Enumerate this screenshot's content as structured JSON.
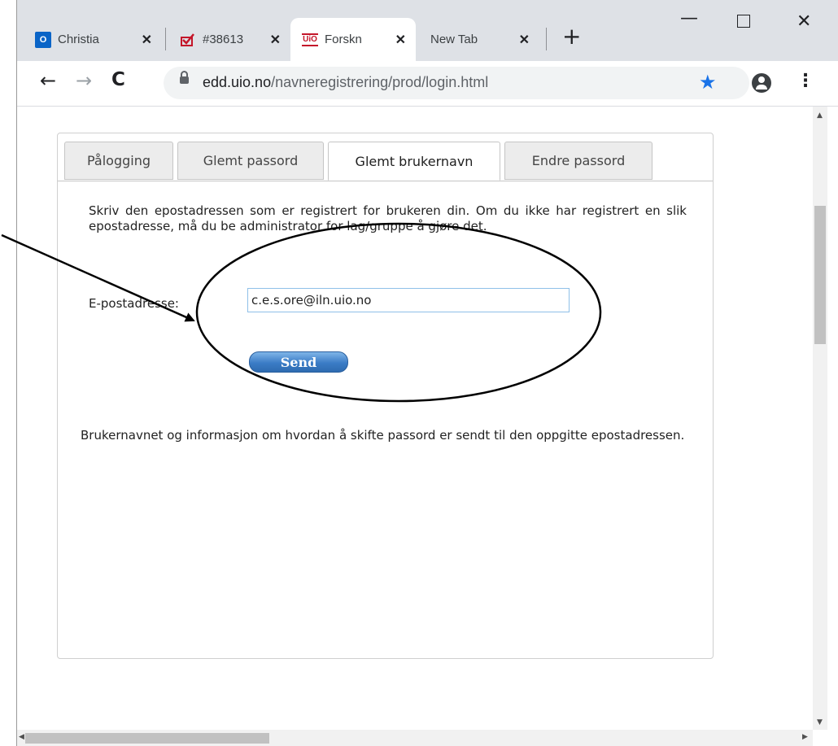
{
  "browser": {
    "tabs": [
      {
        "icon": "outlook-icon",
        "title": "Christia"
      },
      {
        "icon": "checkmark-task-icon",
        "title": "#38613"
      },
      {
        "icon": "uio-icon",
        "title": "Forskn"
      },
      {
        "icon": "",
        "title": "New Tab"
      }
    ],
    "favicon_labels": {
      "outlook": "O",
      "uio": "UiO"
    },
    "url_host": "edd.uio.no",
    "url_path": "/navneregistrering/prod/login.html",
    "accent_color": "#1a73e8"
  },
  "page": {
    "tabs": [
      "Pålogging",
      "Glemt passord",
      "Glemt brukernavn",
      "Endre passord"
    ],
    "active_tab": "Glemt brukernavn",
    "instructions": "Skriv den epostadressen som er registrert for brukeren din. Om du ikke har registrert en slik epostadresse, må du be administrator for lag/gruppe å gjøre det.",
    "email_label": "E-postadresse:",
    "email_value": "c.e.s.ore@iln.uio.no",
    "send_label": "Send",
    "confirmation": "Brukernavnet og informasjon om hvordan å skifte passord er sendt til den oppgitte epostadressen."
  }
}
